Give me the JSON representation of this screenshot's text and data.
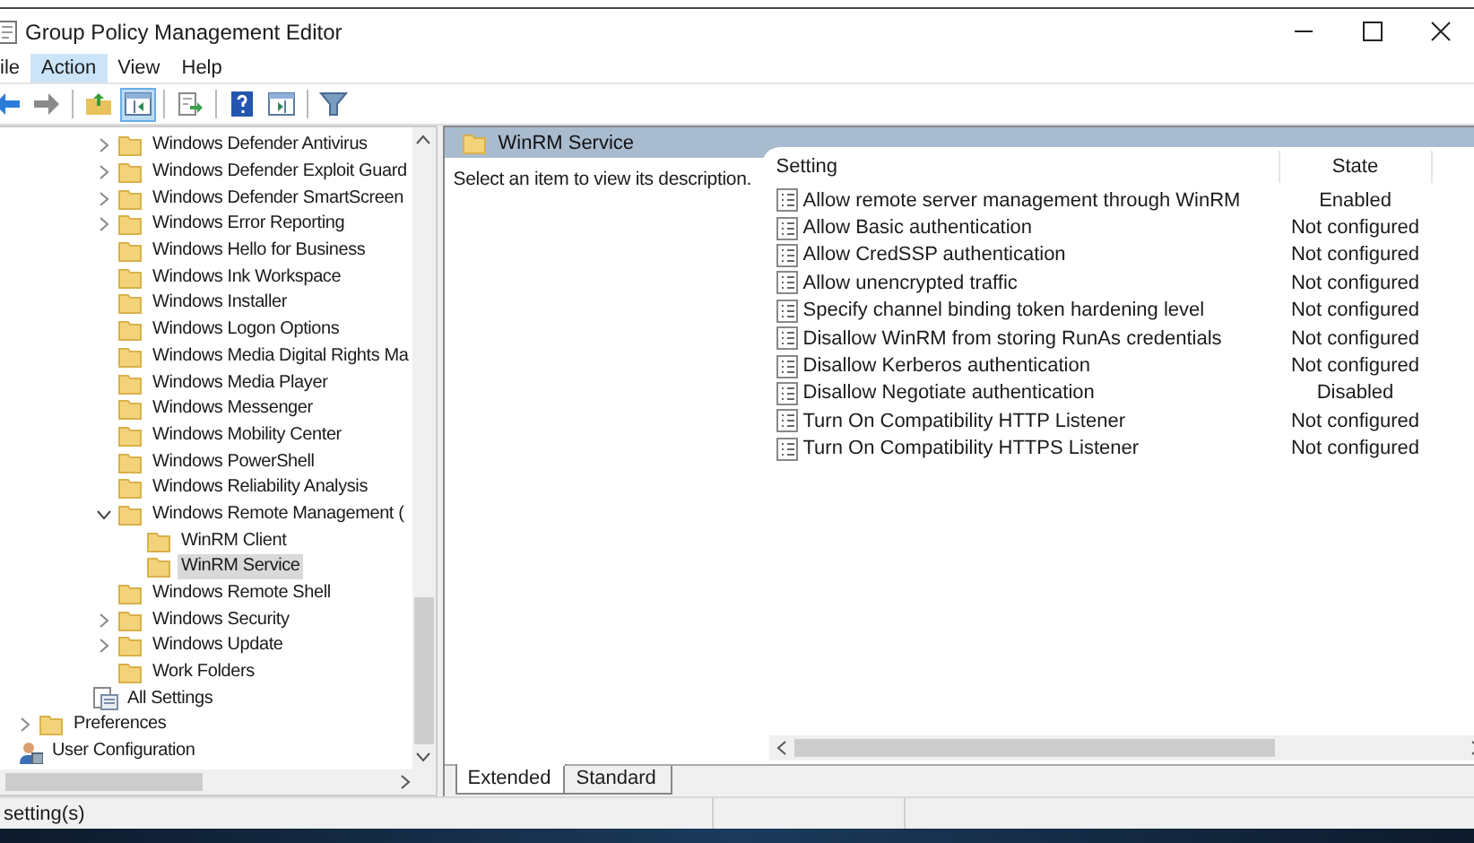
{
  "window": {
    "title": "Group Policy Management Editor"
  },
  "menu": [
    {
      "label": "ile",
      "selected": false
    },
    {
      "label": "Action",
      "selected": true
    },
    {
      "label": "View",
      "selected": false
    },
    {
      "label": "Help",
      "selected": false
    }
  ],
  "toolbar": [
    [
      {
        "kind": "back",
        "pressed": false
      },
      {
        "kind": "forward",
        "pressed": false
      }
    ],
    [
      {
        "kind": "up",
        "pressed": false
      },
      {
        "kind": "tree",
        "pressed": true
      }
    ],
    [
      {
        "kind": "export",
        "pressed": false
      }
    ],
    [
      {
        "kind": "help",
        "pressed": false
      },
      {
        "kind": "panel",
        "pressed": false
      }
    ],
    [
      {
        "kind": "filter",
        "pressed": false
      }
    ]
  ],
  "tree": {
    "component_items": [
      {
        "label": "Windows Defender Antivirus",
        "expandable": true,
        "expanded": false,
        "selected": false
      },
      {
        "label": "Windows Defender Exploit Guard",
        "expandable": true,
        "expanded": false,
        "selected": false
      },
      {
        "label": "Windows Defender SmartScreen",
        "expandable": true,
        "expanded": false,
        "selected": false
      },
      {
        "label": "Windows Error Reporting",
        "expandable": true,
        "expanded": false,
        "selected": false
      },
      {
        "label": "Windows Hello for Business",
        "expandable": false,
        "selected": false
      },
      {
        "label": "Windows Ink Workspace",
        "expandable": false,
        "selected": false
      },
      {
        "label": "Windows Installer",
        "expandable": false,
        "selected": false
      },
      {
        "label": "Windows Logon Options",
        "expandable": false,
        "selected": false
      },
      {
        "label": "Windows Media Digital Rights Ma",
        "expandable": false,
        "selected": false
      },
      {
        "label": "Windows Media Player",
        "expandable": false,
        "selected": false
      },
      {
        "label": "Windows Messenger",
        "expandable": false,
        "selected": false
      },
      {
        "label": "Windows Mobility Center",
        "expandable": false,
        "selected": false
      },
      {
        "label": "Windows PowerShell",
        "expandable": false,
        "selected": false
      },
      {
        "label": "Windows Reliability Analysis",
        "expandable": false,
        "selected": false
      },
      {
        "label": "Windows Remote Management (",
        "expandable": true,
        "expanded": true,
        "selected": false,
        "children": [
          {
            "label": "WinRM Client",
            "expandable": false,
            "selected": false
          },
          {
            "label": "WinRM Service",
            "expandable": false,
            "selected": true
          }
        ]
      },
      {
        "label": "Windows Remote Shell",
        "expandable": false,
        "selected": false
      },
      {
        "label": "Windows Security",
        "expandable": true,
        "expanded": false,
        "selected": false
      },
      {
        "label": "Windows Update",
        "expandable": true,
        "expanded": false,
        "selected": false
      },
      {
        "label": "Work Folders",
        "expandable": false,
        "selected": false
      }
    ],
    "template_items": [
      {
        "label": "All Settings",
        "expandable": false,
        "selected": false
      }
    ],
    "configuration_items": [
      {
        "label": "Preferences",
        "expandable": true,
        "expanded": false,
        "selected": false
      }
    ],
    "root_items": [
      {
        "label": "User Configuration",
        "expandable": false,
        "selected": false
      }
    ]
  },
  "header": {
    "title": "WinRM Service"
  },
  "description": "Select an item to view its description.",
  "table": {
    "columns": [
      "Setting",
      "State"
    ],
    "rows": [
      {
        "setting": "Allow remote server management through WinRM",
        "state": "Enabled"
      },
      {
        "setting": "Allow Basic authentication",
        "state": "Not configured"
      },
      {
        "setting": "Allow CredSSP authentication",
        "state": "Not configured"
      },
      {
        "setting": "Allow unencrypted traffic",
        "state": "Not configured"
      },
      {
        "setting": "Specify channel binding token hardening level",
        "state": "Not configured"
      },
      {
        "setting": "Disallow WinRM from storing RunAs credentials",
        "state": "Not configured"
      },
      {
        "setting": "Disallow Kerberos authentication",
        "state": "Not configured"
      },
      {
        "setting": "Disallow Negotiate authentication",
        "state": "Disabled"
      },
      {
        "setting": "Turn On Compatibility HTTP Listener",
        "state": "Not configured"
      },
      {
        "setting": "Turn On Compatibility HTTPS Listener",
        "state": "Not configured"
      }
    ]
  },
  "tabs": [
    {
      "label": "Extended",
      "selected": true
    },
    {
      "label": "Standard",
      "selected": false
    }
  ],
  "status_bar": {
    "text": "setting(s)"
  }
}
